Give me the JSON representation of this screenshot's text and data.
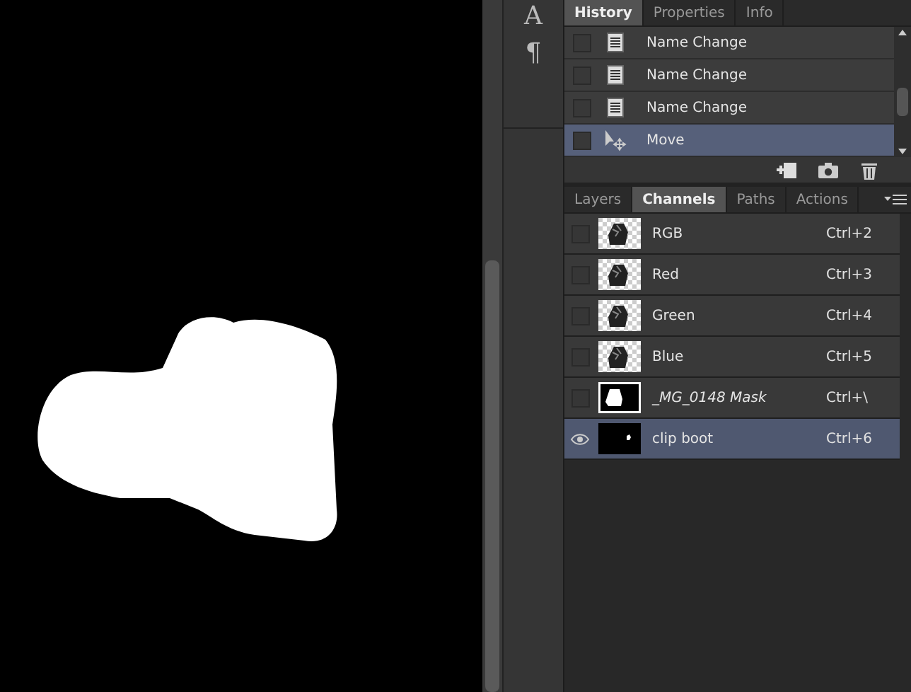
{
  "tool_strip": [
    "A",
    "¶"
  ],
  "history_panel": {
    "tabs": [
      {
        "label": "History",
        "selected": true
      },
      {
        "label": "Properties",
        "selected": false
      },
      {
        "label": "Info",
        "selected": false
      }
    ],
    "steps": [
      {
        "kind": "document",
        "label": "Name Change",
        "selected": false
      },
      {
        "kind": "document",
        "label": "Name Change",
        "selected": false
      },
      {
        "kind": "document",
        "label": "Name Change",
        "selected": false
      },
      {
        "kind": "move",
        "label": "Move",
        "selected": true
      }
    ]
  },
  "channels_panel": {
    "tabs": [
      {
        "label": "Layers",
        "selected": false
      },
      {
        "label": "Channels",
        "selected": true
      },
      {
        "label": "Paths",
        "selected": false
      },
      {
        "label": "Actions",
        "selected": false
      }
    ],
    "channels": [
      {
        "kind": "color",
        "name": "RGB",
        "shortcut": "Ctrl+2",
        "visible": false,
        "selected": false
      },
      {
        "kind": "color",
        "name": "Red",
        "shortcut": "Ctrl+3",
        "visible": false,
        "selected": false
      },
      {
        "kind": "color",
        "name": "Green",
        "shortcut": "Ctrl+4",
        "visible": false,
        "selected": false
      },
      {
        "kind": "color",
        "name": "Blue",
        "shortcut": "Ctrl+5",
        "visible": false,
        "selected": false
      },
      {
        "kind": "mask",
        "name": "_MG_0148 Mask",
        "shortcut": "Ctrl+\\",
        "visible": false,
        "selected": false
      },
      {
        "kind": "alpha",
        "name": "clip boot",
        "shortcut": "Ctrl+6",
        "visible": true,
        "selected": true
      }
    ]
  }
}
